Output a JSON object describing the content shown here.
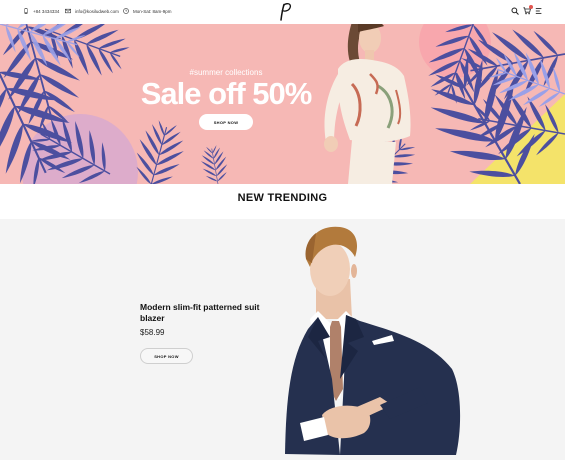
{
  "topbar": {
    "phone": "+84 3434334",
    "email": "info@kosiludweb.com",
    "hours": "Mon-Sat: 8am-9pm",
    "logo_letter": "P",
    "icons": [
      "phone-icon",
      "mail-icon",
      "clock-icon",
      "search-icon",
      "cart-icon",
      "menu-icon"
    ]
  },
  "hero": {
    "subtitle": "#summer collections",
    "title": "Sale off 50%",
    "button": "SHOP NOW",
    "colors": {
      "background": "#f6b8b5",
      "leaf": "#4c4f9f",
      "leaf_light": "#9aa0e8",
      "accent_yellow": "#f4e36a"
    }
  },
  "section": {
    "title": "NEW TRENDING"
  },
  "product": {
    "name": "Modern slim-fit patterned suit blazer",
    "price": "$58.99",
    "button": "SHOP NOW"
  }
}
